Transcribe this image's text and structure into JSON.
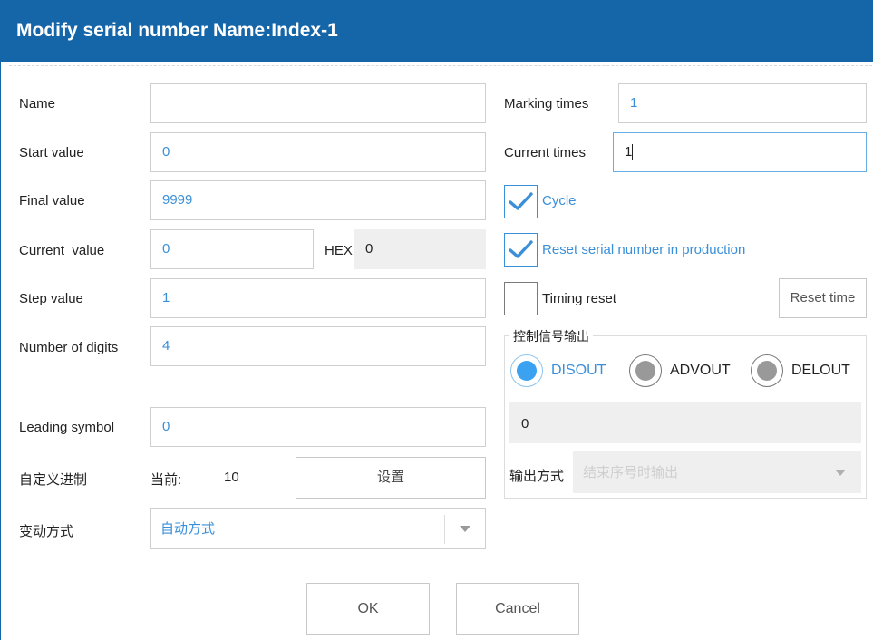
{
  "dialog": {
    "title": "Modify serial number Name:Index-1"
  },
  "left": {
    "name": {
      "label": "Name",
      "value": ""
    },
    "start_value": {
      "label": "Start value",
      "value": "0"
    },
    "final_value": {
      "label": "Final value",
      "value": "9999"
    },
    "current_value": {
      "label": "Current  value",
      "value": "0",
      "hex_label": "HEX",
      "hex_value": "0"
    },
    "step_value": {
      "label": "Step value",
      "value": "1"
    },
    "number_of_digits": {
      "label": "Number of digits",
      "value": "4"
    },
    "leading_symbol": {
      "label": "Leading symbol",
      "value": "0"
    },
    "custom_base": {
      "label": "自定义进制",
      "current_label": "当前:",
      "current_value": "10",
      "set_button": "设置"
    },
    "change_mode": {
      "label": "变动方式",
      "value": "自动方式"
    }
  },
  "right": {
    "marking_times": {
      "label": "Marking times",
      "value": "1"
    },
    "current_times": {
      "label": "Current times",
      "value": "1"
    },
    "cycle": {
      "label": "Cycle",
      "checked": true
    },
    "reset_in_production": {
      "label": "Reset serial number in production",
      "checked": true
    },
    "timing_reset": {
      "label": "Timing reset",
      "checked": false,
      "reset_button": "Reset time"
    },
    "control_signal": {
      "legend": "控制信号输出",
      "options": [
        {
          "label": "DISOUT",
          "selected": true
        },
        {
          "label": "ADVOUT",
          "selected": false
        },
        {
          "label": "DELOUT",
          "selected": false
        }
      ],
      "value": "0",
      "output_mode_label": "输出方式",
      "output_mode_value": "结束序号时输出"
    }
  },
  "footer": {
    "ok": "OK",
    "cancel": "Cancel"
  },
  "colors": {
    "title_bar": "#1565a9",
    "accent": "#3a8fd8",
    "disabled_fill": "#efefef"
  }
}
